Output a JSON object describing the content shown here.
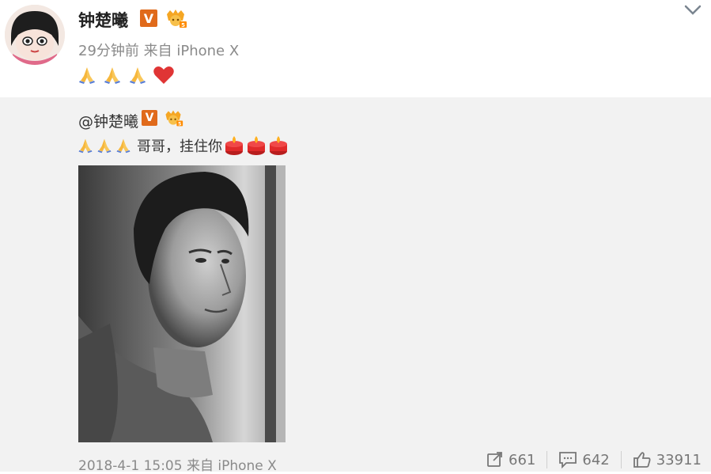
{
  "post": {
    "author": "钟楚曦",
    "verified_mark": "V",
    "time_source": "29分钟前 来自 iPhone X",
    "content_icons": [
      "pray-icon",
      "pray-icon",
      "pray-icon",
      "heart-icon"
    ]
  },
  "repost": {
    "mention": "@钟楚曦",
    "verified_mark": "V",
    "text": "哥哥，挂住你",
    "leading_icons": [
      "pray-icon",
      "pray-icon",
      "pray-icon"
    ],
    "trailing_icons": [
      "candle-icon",
      "candle-icon",
      "candle-icon"
    ],
    "timestamp_source": "2018-4-1 15:05 来自 iPhone X",
    "stats": {
      "reposts": "661",
      "comments": "642",
      "likes": "33911"
    }
  },
  "colors": {
    "verified_orange": "#e06a1b",
    "repost_bg": "#f2f2f2",
    "meta_gray": "#8a8a8a",
    "heart_red": "#e03535"
  }
}
